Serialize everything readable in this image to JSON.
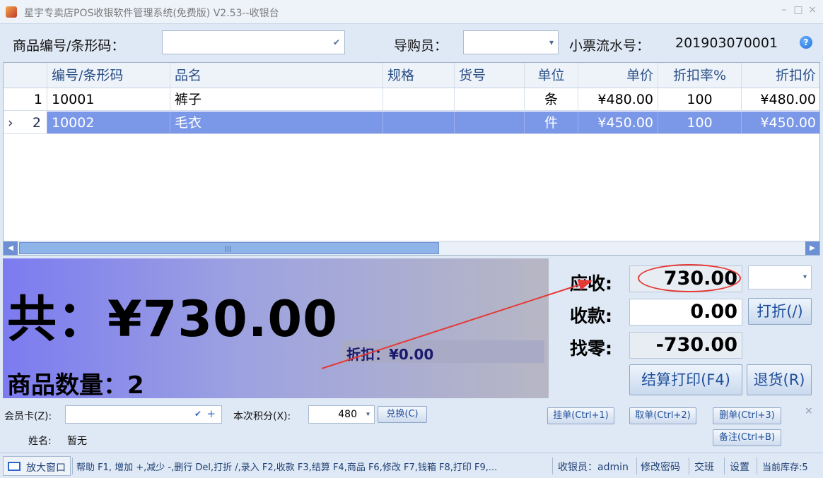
{
  "window": {
    "title": "星宇专卖店POS收银软件管理系统(免费版) V2.53--收银台",
    "min": "–",
    "max": "□",
    "close": "×"
  },
  "search": {
    "barcode_label": "商品编号/条形码：",
    "barcode_value": "",
    "guide_label": "导购员：",
    "guide_value": "",
    "receipt_label": "小票流水号：",
    "receipt_no": "201903070001"
  },
  "table": {
    "columns": [
      "编号/条形码",
      "品名",
      "规格",
      "货号",
      "单位",
      "单价",
      "折扣率%",
      "折扣价"
    ],
    "rows": [
      {
        "num": "1",
        "marker": "",
        "code": "10001",
        "name": "裤子",
        "spec": "",
        "sku": "",
        "unit": "条",
        "price": "¥480.00",
        "rate": "100",
        "disc_price": "¥480.00"
      },
      {
        "num": "2",
        "marker": "›",
        "code": "10002",
        "name": "毛衣",
        "spec": "",
        "sku": "",
        "unit": "件",
        "price": "¥450.00",
        "rate": "100",
        "disc_price": "¥450.00"
      }
    ],
    "scroll_grip": "|||"
  },
  "summary": {
    "total": "共：¥730.00",
    "discount": "折扣：¥0.00",
    "count": "商品数量：2"
  },
  "payment": {
    "due_label": "应收:",
    "due": "730.00",
    "received_label": "收款:",
    "received": "0.00",
    "change_label": "找零:",
    "change": "-730.00",
    "discount_button": "打折(/)",
    "checkout_button": "结算打印(F4)",
    "return_button": "退货(R)"
  },
  "member": {
    "card_label": "会员卡(Z):",
    "card_check": "✔",
    "card_plus": "+",
    "points_label": "本次积分(X):",
    "points": "480",
    "redeem_button": "兑换(C)",
    "name_label": "姓名:",
    "name_value": "暂无",
    "hold_button": "挂单(Ctrl+1)",
    "fetch_button": "取单(Ctrl+2)",
    "delete_button": "删单(Ctrl+3)",
    "note_button": "备注(Ctrl+B)",
    "close": "×"
  },
  "status": {
    "zoom_button": "放大窗口",
    "help": "帮助 F1, 增加 +,减少 -,删行 Del,打折 /,录入 F2,收款 F3,结算 F4,商品 F6,修改 F7,钱箱 F8,打印 F9,...",
    "cashier": "收银员：admin",
    "change_password": "修改密码",
    "shift": "交班",
    "settings": "设置",
    "stock": "当前库存:5"
  },
  "colors": {
    "selected_row": "#7b97e8",
    "annotation": "#e53935"
  }
}
